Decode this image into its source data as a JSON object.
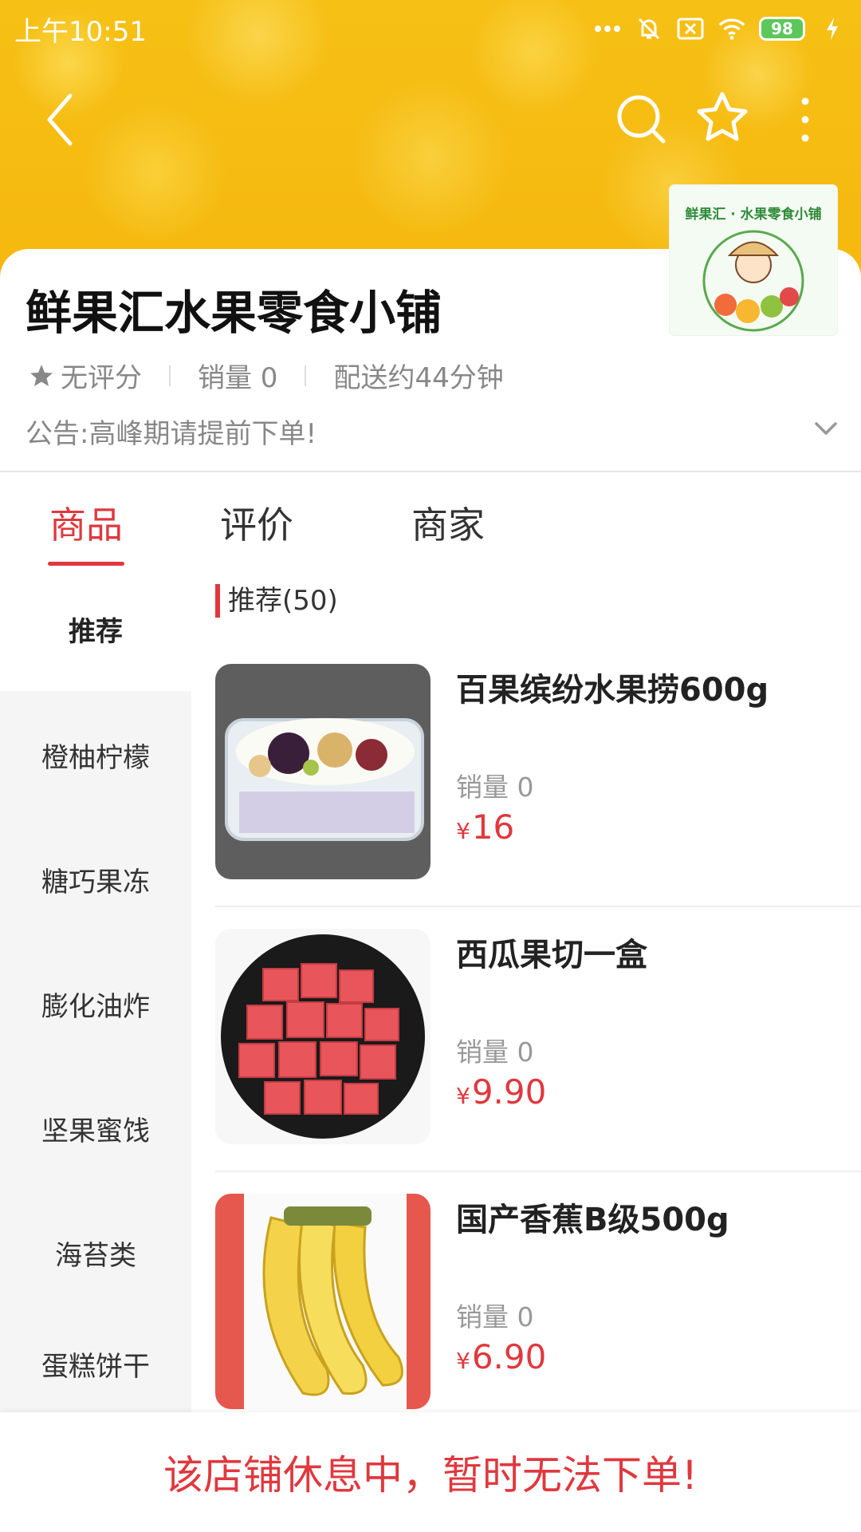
{
  "status_bar": {
    "time": "上午10:51",
    "battery": "98",
    "icons": [
      "dots-icon",
      "mute-icon",
      "sim-off-icon",
      "wifi-icon",
      "battery-icon",
      "charging-icon"
    ]
  },
  "nav": {
    "icons": [
      "back-icon",
      "search-icon",
      "star-icon",
      "more-icon"
    ]
  },
  "store": {
    "name": "鲜果汇水果零食小铺",
    "rating": "无评分",
    "sales": "销量 0",
    "delivery": "配送约44分钟",
    "notice": "公告:高峰期请提前下单!",
    "logo_text": "鲜果汇 · 水果零食小铺"
  },
  "tabs": [
    {
      "label": "商品",
      "active": true
    },
    {
      "label": "评价",
      "active": false
    },
    {
      "label": "商家",
      "active": false
    }
  ],
  "categories": [
    {
      "label": "推荐",
      "active": true
    },
    {
      "label": "橙柚柠檬",
      "active": false
    },
    {
      "label": "糖巧果冻",
      "active": false
    },
    {
      "label": "膨化油炸",
      "active": false
    },
    {
      "label": "坚果蜜饯",
      "active": false
    },
    {
      "label": "海苔类",
      "active": false
    },
    {
      "label": "蛋糕饼干",
      "active": false
    }
  ],
  "section": {
    "title": "推荐(50)"
  },
  "products": [
    {
      "name": "百果缤纷水果捞600g",
      "sales": "销量 0",
      "currency": "¥",
      "price": "16"
    },
    {
      "name": "西瓜果切一盒",
      "sales": "销量 0",
      "currency": "¥",
      "price": "9.90"
    },
    {
      "name": "国产香蕉B级500g",
      "sales": "销量 0",
      "currency": "¥",
      "price": "6.90"
    }
  ],
  "bottom": {
    "message": "该店铺休息中，暂时无法下单!"
  },
  "colors": {
    "accent": "#e0383e",
    "header": "#f5b80f",
    "sidebar": "#f5f5f5"
  }
}
